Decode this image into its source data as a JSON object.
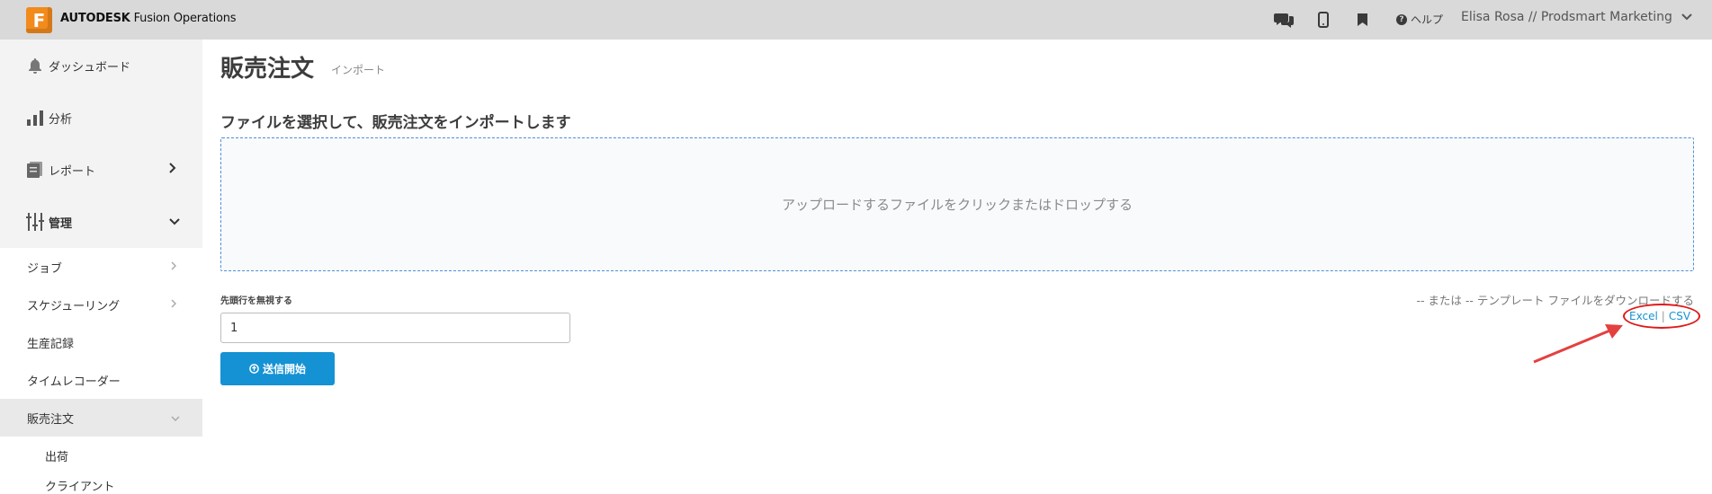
{
  "topbar": {
    "logo_letter": "F",
    "brand_bold": "AUTODESK",
    "brand_rest": " Fusion Operations",
    "help_label": "ヘルプ",
    "user_label": "Elisa Rosa // Prodsmart Marketing",
    "icons": [
      "chat-icon",
      "mobile-icon",
      "bookmark-icon",
      "help-icon",
      "chevron-down-icon"
    ]
  },
  "sidebar": {
    "items": [
      {
        "label": "ダッシュボード",
        "icon": "bell-icon"
      },
      {
        "label": "分析",
        "icon": "bar-chart-icon"
      },
      {
        "label": "レポート",
        "icon": "report-icon"
      },
      {
        "label": "管理",
        "icon": "sliders-icon"
      }
    ],
    "admin_subitems": [
      {
        "label": "ジョブ"
      },
      {
        "label": "スケジューリング"
      },
      {
        "label": "生産記録"
      },
      {
        "label": "タイムレコーダー"
      },
      {
        "label": "販売注文"
      }
    ],
    "sales_subitems": [
      {
        "label": "出荷"
      },
      {
        "label": "クライアント"
      }
    ]
  },
  "main": {
    "page_title": "販売注文",
    "breadcrumb": "インポート",
    "section_title": "ファイルを選択して、販売注文をインポートします",
    "dropzone_text": "アップロードするファイルをクリックまたはドロップする",
    "skip_label": "先頭行を無視する",
    "skip_value": "1",
    "submit_label": "送信開始",
    "template_text": "-- または -- テンプレート ファイルをダウンロードする",
    "template_excel": "Excel",
    "template_sep": "|",
    "template_csv": "CSV"
  },
  "colors": {
    "accent": "#1592d3",
    "logo_orange": "#f28a1c",
    "annotation_red": "#e01919",
    "topbar_bg": "#d9d9d9",
    "sidebar_bg": "#f3f3f3"
  }
}
